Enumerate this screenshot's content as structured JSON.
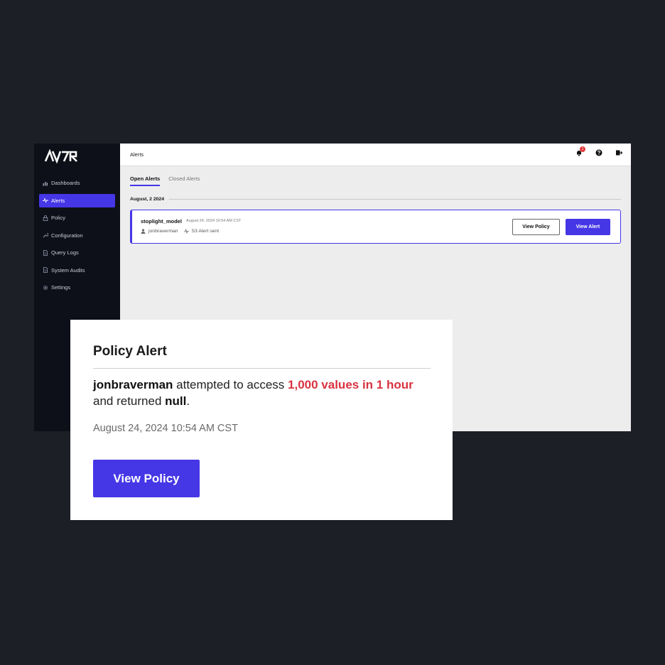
{
  "brand": {
    "logo_text": "ALTR",
    "accent": "#4536e6",
    "danger": "#d93240",
    "sidebar_bg": "#0e1019"
  },
  "sidebar": {
    "items": [
      {
        "label": "Dashboards",
        "icon": "bar-chart-icon"
      },
      {
        "label": "Alerts",
        "icon": "pulse-icon",
        "active": true
      },
      {
        "label": "Policy",
        "icon": "lock-icon"
      },
      {
        "label": "Configuration",
        "icon": "wrench-icon"
      },
      {
        "label": "Query Logs",
        "icon": "document-icon"
      },
      {
        "label": "System Audits",
        "icon": "document-icon"
      },
      {
        "label": "Settings",
        "icon": "gear-icon"
      }
    ]
  },
  "header": {
    "title": "Alerts",
    "notification_count": "1",
    "icons": [
      "bell-icon",
      "help-icon",
      "logout-icon"
    ]
  },
  "tabs": [
    {
      "label": "Open Alerts",
      "active": true
    },
    {
      "label": "Closed Alerts",
      "active": false
    }
  ],
  "alerts": {
    "date_group": "August, 2 2024",
    "items": [
      {
        "name": "stoplight_model",
        "timestamp": "August 24, 2024 10:54 AM CST",
        "user": "jonbraverman",
        "event": "S3 Alert sent",
        "view_policy_label": "View Policy",
        "view_alert_label": "View Alert"
      }
    ]
  },
  "popup": {
    "title": "Policy Alert",
    "user": "jonbraverman",
    "text_1": " attempted to access ",
    "highlight": "1,000 values in 1 hour",
    "text_2": " and returned ",
    "result": "null",
    "text_3": ".",
    "timestamp": "August 24, 2024 10:54 AM CST",
    "button_label": "View Policy"
  }
}
